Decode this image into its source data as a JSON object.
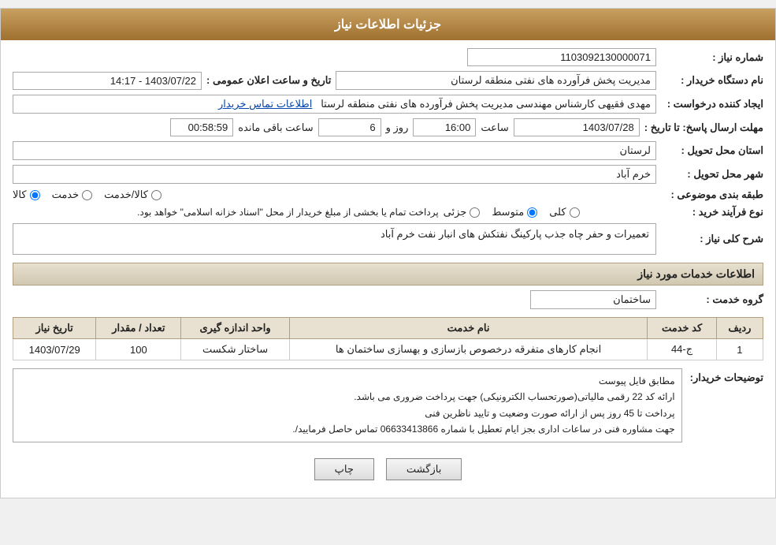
{
  "header": {
    "title": "جزئیات اطلاعات نیاز"
  },
  "fields": {
    "request_number_label": "شماره نیاز :",
    "request_number_value": "1103092130000071",
    "buyer_org_label": "نام دستگاه خریدار :",
    "buyer_org_value": "مدیریت پخش فرآورده های نفتی منطقه لرستان",
    "requester_label": "ایجاد کننده درخواست :",
    "requester_value": "مهدی فقیهی کارشناس مهندسی مدیریت پخش فرآورده های نفتی منطقه لرستا",
    "contact_link": "اطلاعات تماس خریدار",
    "announce_datetime_label": "تاریخ و ساعت اعلان عمومی :",
    "announce_datetime_value": "1403/07/22 - 14:17",
    "reply_deadline_label": "مهلت ارسال پاسخ: تا تاریخ :",
    "reply_date": "1403/07/28",
    "reply_time_label": "ساعت",
    "reply_time": "16:00",
    "reply_days_label": "روز و",
    "reply_days": "6",
    "reply_remaining_label": "ساعت باقی مانده",
    "reply_remaining": "00:58:59",
    "province_label": "استان محل تحویل :",
    "province_value": "لرستان",
    "city_label": "شهر محل تحویل :",
    "city_value": "خرم آباد",
    "category_label": "طبقه بندی موضوعی :",
    "category_options": [
      {
        "label": "کالا",
        "value": "kala"
      },
      {
        "label": "خدمت",
        "value": "khedmat"
      },
      {
        "label": "کالا/خدمت",
        "value": "kala_khedmat"
      }
    ],
    "category_selected": "kala",
    "process_label": "نوع فرآیند خرید :",
    "process_options": [
      {
        "label": "جزئی",
        "value": "joz"
      },
      {
        "label": "متوسط",
        "value": "motas"
      },
      {
        "label": "کلی",
        "value": "koli"
      }
    ],
    "process_selected": "motas",
    "process_note": "پرداخت تمام یا بخشی از مبلغ خریدار از محل \"اسناد خزانه اسلامی\" خواهد بود.",
    "description_label": "شرح کلی نیاز :",
    "description_value": "تعمیرات و حفر چاه جذب پارکینگ نفتکش های انبار نفت خرم آباد",
    "services_section": "اطلاعات خدمات مورد نیاز",
    "service_group_label": "گروه خدمت :",
    "service_group_value": "ساختمان",
    "table": {
      "columns": [
        "ردیف",
        "کد خدمت",
        "نام خدمت",
        "واحد اندازه گیری",
        "تعداد / مقدار",
        "تاریخ نیاز"
      ],
      "rows": [
        {
          "row_num": "1",
          "service_code": "ج-44",
          "service_name": "انجام کارهای متفرقه درخصوص بازسازی و بهسازی ساختمان ها",
          "unit": "ساختار شکست",
          "quantity": "100",
          "date": "1403/07/29"
        }
      ]
    },
    "buyer_notes_label": "توضیحات خریدار:",
    "buyer_notes": "مطابق فایل پیوست\nارائه کد 22 رقمی مالیاتی(صورتحساب الکترونیکی) جهت پرداخت ضروری می باشد.\nپرداخت تا 45 روز پس از ارائه صورت وضعیت و تایید ناظرین فنی\nجهت مشاوره فنی در ساعات اداری بجز ایام تعطیل با شماره 06633413866 تماس حاصل فرمایید/.",
    "buttons": {
      "print": "چاپ",
      "back": "بازگشت"
    }
  }
}
